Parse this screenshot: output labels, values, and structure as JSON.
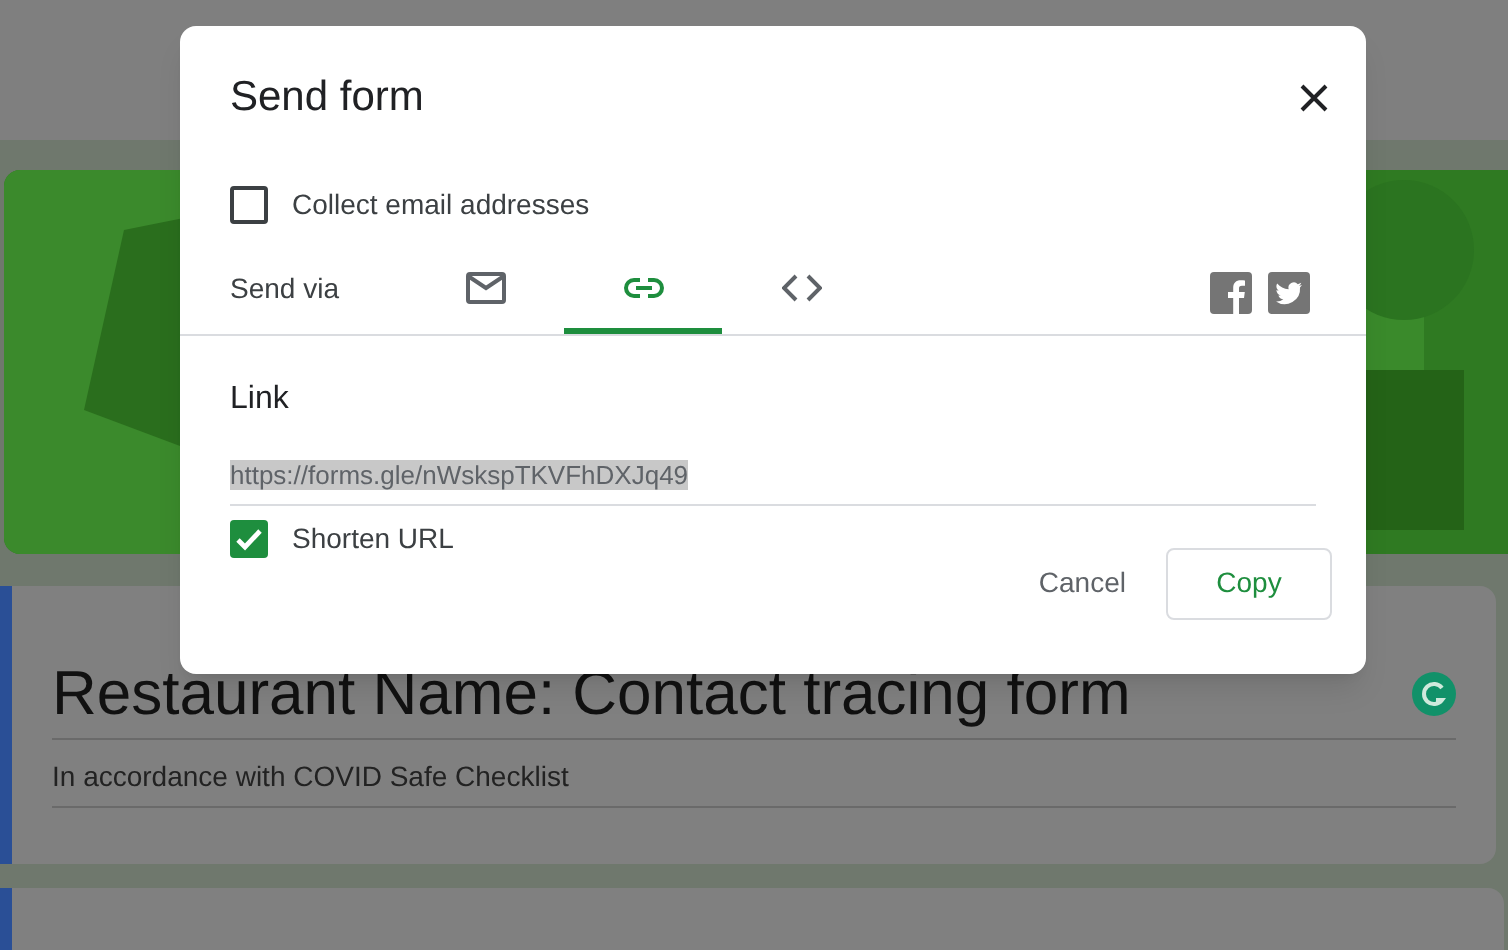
{
  "dialog": {
    "title": "Send form",
    "collect_email": {
      "label": "Collect email addresses",
      "checked": false
    },
    "send_via": {
      "label": "Send via",
      "tabs": [
        {
          "kind": "email",
          "selected": false
        },
        {
          "kind": "link",
          "selected": true
        },
        {
          "kind": "embed",
          "selected": false
        }
      ]
    },
    "link": {
      "heading": "Link",
      "url": "https://forms.gle/nWskspTKVFhDXJq49",
      "shorten_url": {
        "label": "Shorten URL",
        "checked": true
      }
    },
    "buttons": [
      {
        "label": "Cancel",
        "kind": "text"
      },
      {
        "label": "Copy",
        "kind": "outlined"
      }
    ]
  },
  "form": {
    "title": "Restaurant Name: Contact tracing form",
    "description": "In accordance with COVID Safe Checklist"
  }
}
